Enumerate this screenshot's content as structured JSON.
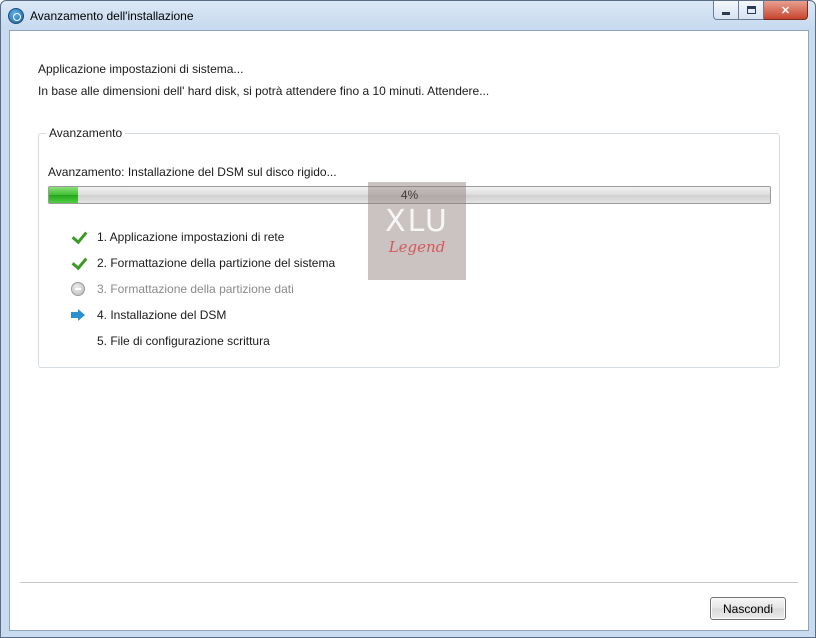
{
  "window": {
    "title": "Avanzamento dell'installazione",
    "icon": "app-icon"
  },
  "messages": {
    "line1": "Applicazione impostazioni di sistema...",
    "line2": "In base alle dimensioni dell' hard disk, si potrà attendere fino a 10 minuti. Attendere..."
  },
  "progress_group": {
    "label": "Avanzamento",
    "status": "Avanzamento: Installazione del DSM sul disco rigido...",
    "percent_text": "4%",
    "percent": 4
  },
  "steps": [
    {
      "label": "1. Applicazione impostazioni di rete",
      "state": "done",
      "icon": "check-icon"
    },
    {
      "label": "2. Formattazione della partizione del sistema",
      "state": "done",
      "icon": "check-icon"
    },
    {
      "label": "3. Formattazione della partizione dati",
      "state": "skipped",
      "icon": "skip-icon"
    },
    {
      "label": "4. Installazione del DSM",
      "state": "current",
      "icon": "arrow-right-icon"
    },
    {
      "label": "5. File di configurazione scrittura",
      "state": "pending",
      "icon": ""
    }
  ],
  "watermark": {
    "top": "XLU",
    "bottom": "Legend"
  },
  "footer": {
    "hide_label": "Nascondi"
  },
  "colors": {
    "progress_fill": "#3fbd33",
    "check": "#3d9a25",
    "arrow": "#2b8fd0",
    "close_button": "#c7452e"
  }
}
